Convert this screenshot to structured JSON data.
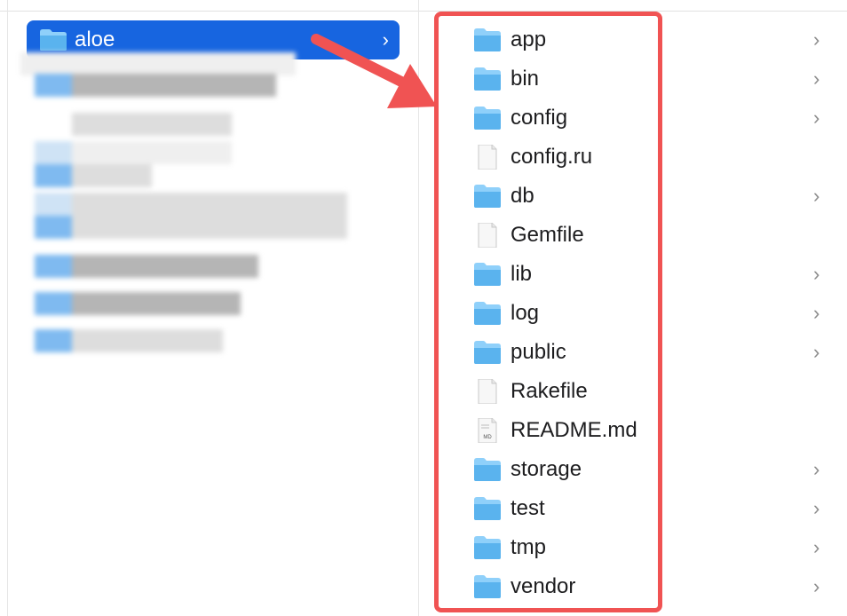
{
  "window": {
    "view": "column-view"
  },
  "left_column": {
    "selected_folder": {
      "label": "aloe",
      "icon": "folder-icon",
      "chevron": "›"
    }
  },
  "right_column": {
    "items": [
      {
        "name": "app",
        "type": "folder",
        "icon": "folder-icon",
        "chevron": "›"
      },
      {
        "name": "bin",
        "type": "folder",
        "icon": "folder-icon",
        "chevron": "›"
      },
      {
        "name": "config",
        "type": "folder",
        "icon": "folder-icon",
        "chevron": "›"
      },
      {
        "name": "config.ru",
        "type": "file",
        "icon": "document-icon",
        "chevron": ""
      },
      {
        "name": "db",
        "type": "folder",
        "icon": "folder-icon",
        "chevron": "›"
      },
      {
        "name": "Gemfile",
        "type": "file",
        "icon": "document-icon",
        "chevron": ""
      },
      {
        "name": "lib",
        "type": "folder",
        "icon": "folder-icon",
        "chevron": "›"
      },
      {
        "name": "log",
        "type": "folder",
        "icon": "folder-icon",
        "chevron": "›"
      },
      {
        "name": "public",
        "type": "folder",
        "icon": "folder-icon",
        "chevron": "›"
      },
      {
        "name": "Rakefile",
        "type": "file",
        "icon": "document-icon",
        "chevron": ""
      },
      {
        "name": "README.md",
        "type": "markdown",
        "icon": "markdown-file-icon",
        "badge": "MD",
        "chevron": ""
      },
      {
        "name": "storage",
        "type": "folder",
        "icon": "folder-icon",
        "chevron": "›"
      },
      {
        "name": "test",
        "type": "folder",
        "icon": "folder-icon",
        "chevron": "›"
      },
      {
        "name": "tmp",
        "type": "folder",
        "icon": "folder-icon",
        "chevron": "›"
      },
      {
        "name": "vendor",
        "type": "folder",
        "icon": "folder-icon",
        "chevron": "›"
      }
    ]
  },
  "annotations": {
    "highlight_color": "#f05353",
    "arrow_color": "#f05353"
  },
  "colors": {
    "selection": "#1765e0",
    "folder_blue": "#5ab0ee"
  }
}
